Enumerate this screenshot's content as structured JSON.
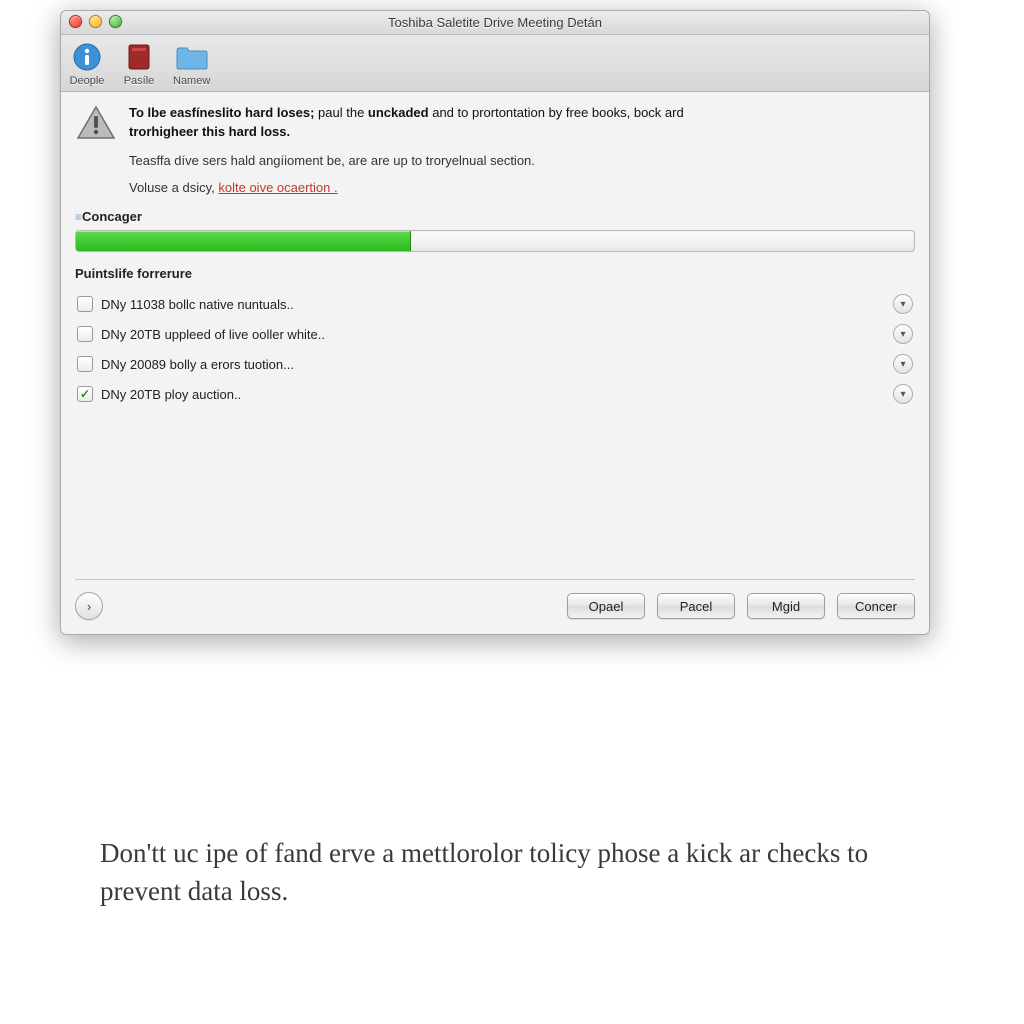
{
  "window": {
    "title": "Toshiba Saletite Drive Meeting Detán"
  },
  "toolbar": {
    "items": [
      {
        "label": "Deople",
        "icon": "info-icon"
      },
      {
        "label": "Pasíle",
        "icon": "book-icon"
      },
      {
        "label": "Namew",
        "icon": "folder-icon"
      }
    ]
  },
  "warning": {
    "line1_prefix": "To lbe easfíneslito hard loses;",
    "line1_mid": " paul the ",
    "line1_bold1": "unckaded",
    "line1_mid2": "  and to prortontation by free books, bock ard ",
    "line2_bold": "trorhigheer this hard loss.",
    "sub": "Teasffa díve sers hald angíioment be, are are up to troryelnual section.",
    "link_plain": "Voluse a dsicy, ",
    "link_red": "kolte oive ocaertion ."
  },
  "progress": {
    "label": "Concager",
    "percent": 40
  },
  "options": {
    "header": "Puintslife forrerure",
    "items": [
      {
        "label": "DNy 11038 bollc native nuntuals..",
        "checked": false
      },
      {
        "label": "DNy 20TB uppleed of live ooller white..",
        "checked": false
      },
      {
        "label": "DNy 20089 bolly a erors tuotion...",
        "checked": false
      },
      {
        "label": "DNy 20TB  ploy auction..",
        "checked": true
      }
    ]
  },
  "footer": {
    "buttons": {
      "opad": "Opael",
      "pacel": "Pacel",
      "mgid": "Mgid",
      "concer": "Concer"
    }
  },
  "caption": "Don'tt uc ipe of fand erve a mettlorolor tolicy phose a kick ar checks to prevent data loss."
}
